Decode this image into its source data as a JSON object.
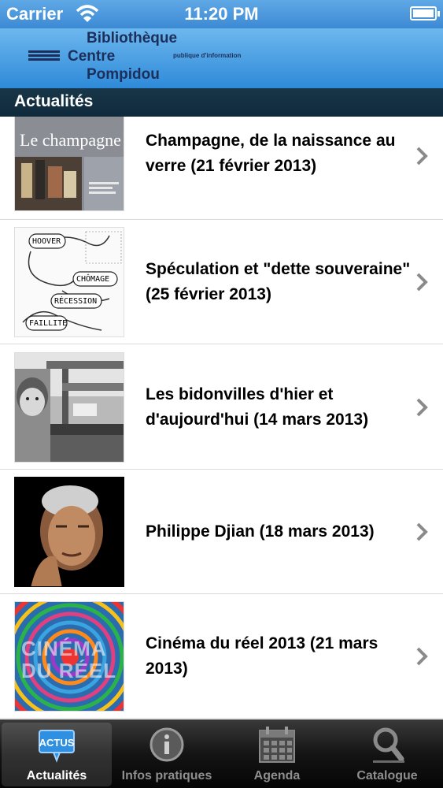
{
  "status_bar": {
    "carrier": "Carrier",
    "time": "11:20 PM"
  },
  "header": {
    "logo_line1": "Bibliothèque",
    "logo_line2": "Centre",
    "logo_line3": "Pompidou",
    "logo_sub": "publique d'information"
  },
  "section": {
    "title": "Actualités"
  },
  "items": [
    {
      "title": "Champagne, de la naissance au verre (21 février 2013)",
      "thumb_text": "Le champagne"
    },
    {
      "title": "Spéculation et \"dette souveraine\" (25 février 2013)",
      "thumb_words": [
        "HOOVER",
        "CHÔMAGE",
        "RÉCESSION",
        "FAILLITE"
      ]
    },
    {
      "title": "Les bidonvilles d'hier et d'aujourd'hui (14 mars 2013)"
    },
    {
      "title": "Philippe Djian (18 mars 2013)"
    },
    {
      "title": "Cinéma du réel 2013 (21 mars 2013)",
      "thumb_text_1": "CINÉMA",
      "thumb_text_2": "DU RÉEL"
    }
  ],
  "tabbar": {
    "tabs": [
      {
        "label": "Actualités",
        "icon": "actus-icon",
        "icon_text": "ACTUS",
        "active": true
      },
      {
        "label": "Infos pratiques",
        "icon": "info-icon",
        "active": false
      },
      {
        "label": "Agenda",
        "icon": "calendar-icon",
        "active": false
      },
      {
        "label": "Catalogue",
        "icon": "search-icon",
        "active": false
      }
    ]
  },
  "colors": {
    "header_blue": "#3d8ad4",
    "section_dark": "#0f2a3b",
    "tab_dark": "#141414"
  }
}
